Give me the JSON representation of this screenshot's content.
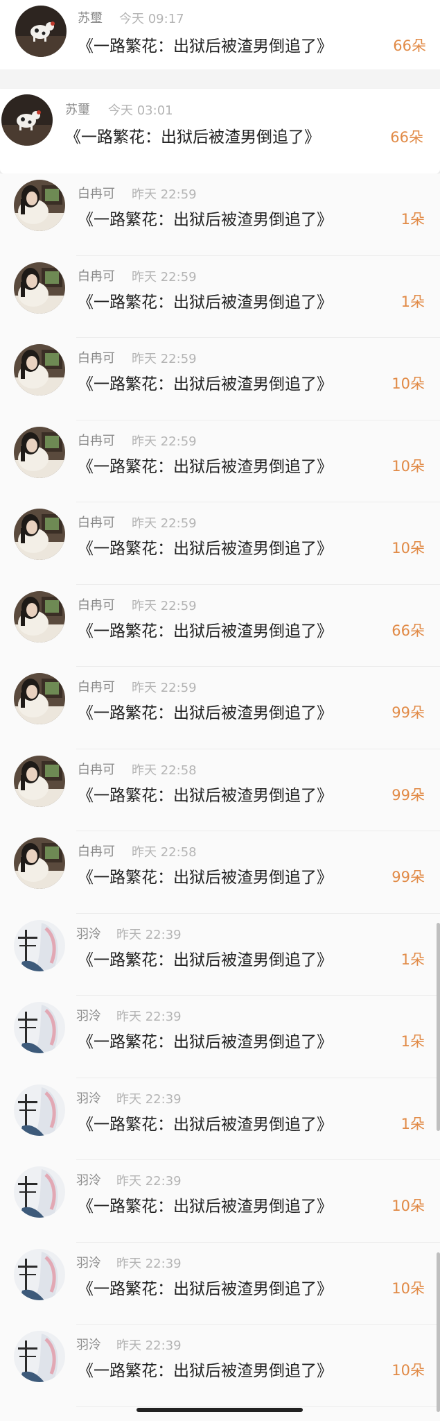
{
  "pinned": [
    {
      "name": "苏璽",
      "time": "今天 09:17",
      "message": "《一路繁花：出狱后被渣男倒追了》",
      "count": "66朵"
    },
    {
      "name": "苏璽",
      "time": "今天 03:01",
      "message": "《一路繁花：出狱后被渣男倒追了》",
      "count": "66朵"
    }
  ],
  "rows": [
    {
      "name": "白冉可",
      "time": "昨天 22:59",
      "message": "《一路繁花：出狱后被渣男倒追了》",
      "count": "1朵",
      "avatar": "girl"
    },
    {
      "name": "白冉可",
      "time": "昨天 22:59",
      "message": "《一路繁花：出狱后被渣男倒追了》",
      "count": "1朵",
      "avatar": "girl"
    },
    {
      "name": "白冉可",
      "time": "昨天 22:59",
      "message": "《一路繁花：出狱后被渣男倒追了》",
      "count": "10朵",
      "avatar": "girl"
    },
    {
      "name": "白冉可",
      "time": "昨天 22:59",
      "message": "《一路繁花：出狱后被渣男倒追了》",
      "count": "10朵",
      "avatar": "girl"
    },
    {
      "name": "白冉可",
      "time": "昨天 22:59",
      "message": "《一路繁花：出狱后被渣男倒追了》",
      "count": "10朵",
      "avatar": "girl"
    },
    {
      "name": "白冉可",
      "time": "昨天 22:59",
      "message": "《一路繁花：出狱后被渣男倒追了》",
      "count": "66朵",
      "avatar": "girl"
    },
    {
      "name": "白冉可",
      "time": "昨天 22:59",
      "message": "《一路繁花：出狱后被渣男倒追了》",
      "count": "99朵",
      "avatar": "girl"
    },
    {
      "name": "白冉可",
      "time": "昨天 22:58",
      "message": "《一路繁花：出狱后被渣男倒追了》",
      "count": "99朵",
      "avatar": "girl"
    },
    {
      "name": "白冉可",
      "time": "昨天 22:58",
      "message": "《一路繁花：出狱后被渣男倒追了》",
      "count": "99朵",
      "avatar": "girl"
    },
    {
      "name": "羽泠",
      "time": "昨天 22:39",
      "message": "《一路繁花：出狱后被渣男倒追了》",
      "count": "1朵",
      "avatar": "anime"
    },
    {
      "name": "羽泠",
      "time": "昨天 22:39",
      "message": "《一路繁花：出狱后被渣男倒追了》",
      "count": "1朵",
      "avatar": "anime"
    },
    {
      "name": "羽泠",
      "time": "昨天 22:39",
      "message": "《一路繁花：出狱后被渣男倒追了》",
      "count": "1朵",
      "avatar": "anime"
    },
    {
      "name": "羽泠",
      "time": "昨天 22:39",
      "message": "《一路繁花：出狱后被渣男倒追了》",
      "count": "10朵",
      "avatar": "anime"
    },
    {
      "name": "羽泠",
      "time": "昨天 22:39",
      "message": "《一路繁花：出狱后被渣男倒追了》",
      "count": "10朵",
      "avatar": "anime"
    },
    {
      "name": "羽泠",
      "time": "昨天 22:39",
      "message": "《一路繁花：出狱后被渣男倒追了》",
      "count": "10朵",
      "avatar": "anime"
    }
  ],
  "colors": {
    "count": "#e18a46",
    "name": "#8a8a8a",
    "time": "#b4b4b4",
    "message": "#222222"
  }
}
